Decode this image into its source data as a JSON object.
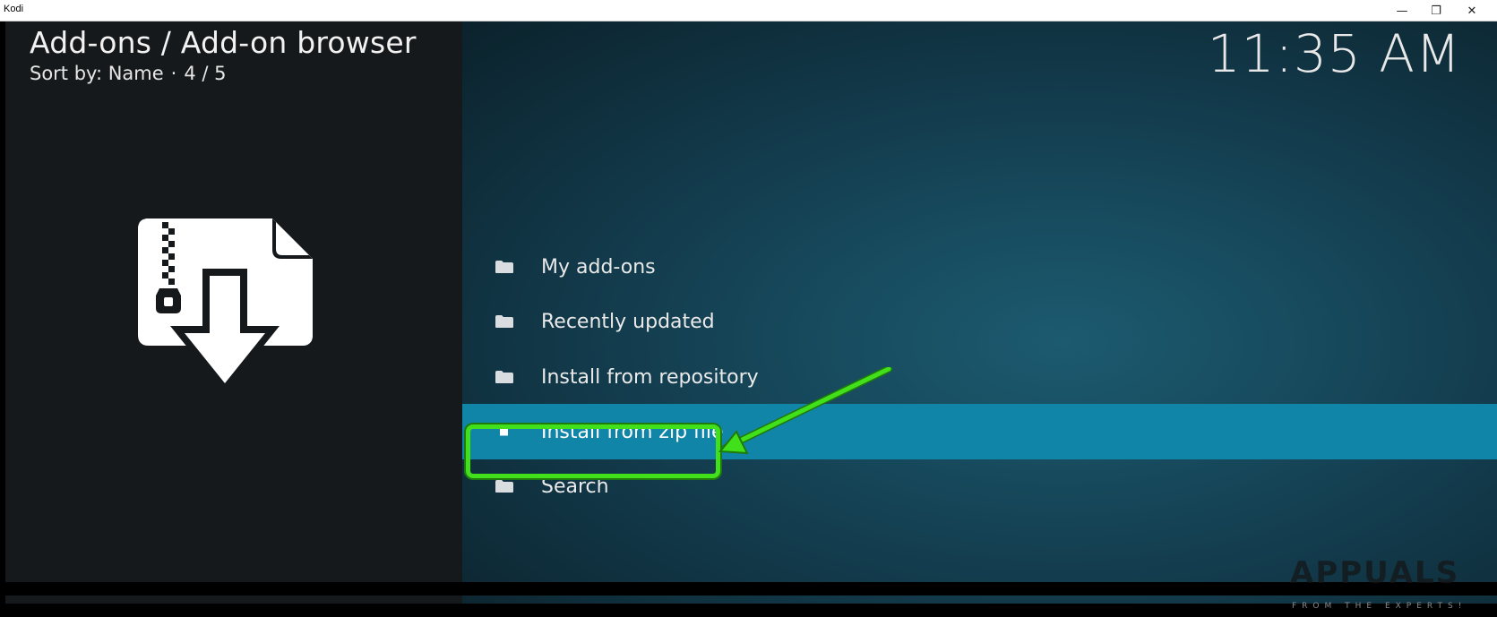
{
  "window": {
    "title": "Kodi",
    "minimize_glyph": "—",
    "maximize_glyph": "❐",
    "close_glyph": "✕"
  },
  "header": {
    "title": "Add-ons / Add-on browser",
    "sort_label": "Sort by: Name",
    "separator": "·",
    "position": "4 / 5"
  },
  "clock": "11:35 AM",
  "preview_icon": "zip-install-icon",
  "menu": {
    "items": [
      {
        "label": "My add-ons",
        "icon": "folder-icon"
      },
      {
        "label": "Recently updated",
        "icon": "folder-icon"
      },
      {
        "label": "Install from repository",
        "icon": "folder-icon"
      },
      {
        "label": "Install from zip file",
        "icon": "selected-square-icon",
        "selected": true
      },
      {
        "label": "Search",
        "icon": "folder-icon"
      }
    ]
  },
  "annotation": {
    "highlight_color": "#42e01a"
  },
  "watermark": {
    "brand": "APPUALS",
    "tagline": "FROM THE EXPERTS!"
  },
  "colors": {
    "selection": "#1185a7",
    "left_panel": "#16191b",
    "right_panel": "#174a5d"
  }
}
